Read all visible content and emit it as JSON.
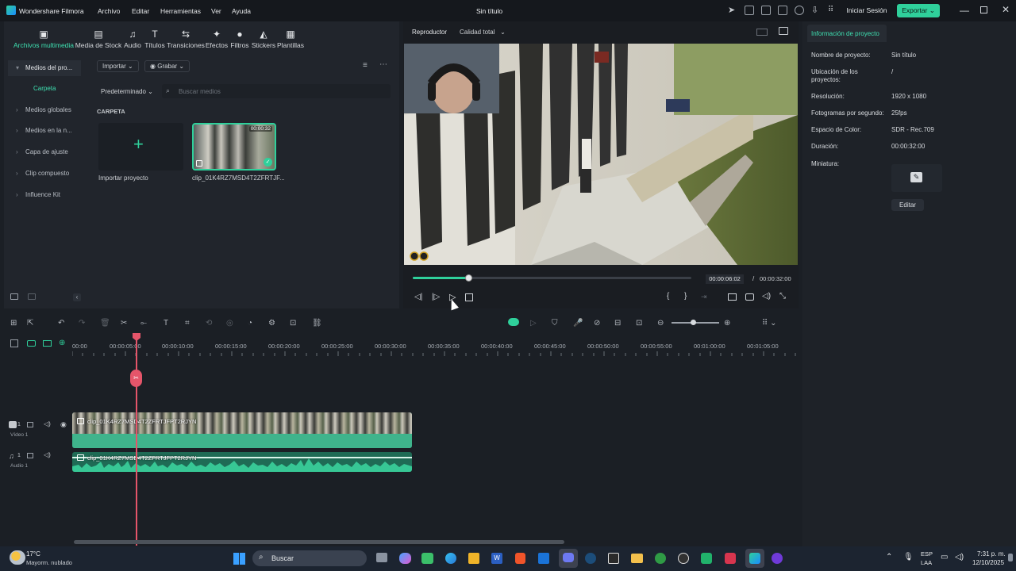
{
  "app": {
    "name": "Wondershare Filmora",
    "title": "Sin título"
  },
  "menu": [
    "Archivo",
    "Editar",
    "Herramientas",
    "Ver",
    "Ayuda"
  ],
  "header": {
    "login": "Iniciar Sesión",
    "export": "Exportar"
  },
  "media_tabs": [
    "Archivos multimedia",
    "Media de Stock",
    "Audio",
    "Títulos",
    "Transiciones",
    "Efectos",
    "Filtros",
    "Stickers",
    "Plantillas"
  ],
  "sidebar": {
    "items": [
      "Medios del pro...",
      "Carpeta",
      "Medios globales",
      "Medios en la n...",
      "Capa de ajuste",
      "Clip compuesto",
      "Influence Kit"
    ]
  },
  "media": {
    "import_btn": "Importar",
    "record_btn": "Grabar",
    "sort": "Predeterminado",
    "search_placeholder": "Buscar medios",
    "folder_heading": "CARPETA",
    "import_project": "Importar proyecto",
    "clip_name": "clip_01K4RZ7MSD4T2ZFRTJF...",
    "clip_duration": "00:00:32"
  },
  "player": {
    "label": "Reproductor",
    "quality": "Calidad total",
    "current_time": "00:00:06:02",
    "separator": "/",
    "total_time": "00:00:32:00",
    "progress": 0.2
  },
  "project_info": {
    "title": "Información de proyecto",
    "rows": [
      {
        "label": "Nombre de proyecto:",
        "value": "Sin título"
      },
      {
        "label": "Ubicación de los proyectos:",
        "value": "/"
      },
      {
        "label": "Resolución:",
        "value": "1920 x 1080"
      },
      {
        "label": "Fotogramas por segundo:",
        "value": "25fps"
      },
      {
        "label": "Espacio de Color:",
        "value": "SDR - Rec.709"
      },
      {
        "label": "Duración:",
        "value": "00:00:32:00"
      },
      {
        "label": "Miniatura:",
        "value": ""
      }
    ],
    "edit_btn": "Editar"
  },
  "timeline": {
    "ruler": [
      "00:00",
      "00:00:05:00",
      "00:00:10:00",
      "00:00:15:00",
      "00:00:20:00",
      "00:00:25:00",
      "00:00:30:00",
      "00:00:35:00",
      "00:00:40:00",
      "00:00:45:00",
      "00:00:50:00",
      "00:00:55:00",
      "00:01:00:00",
      "00:01:05:00"
    ],
    "video_track": {
      "num": "1",
      "label": "Vídeo 1"
    },
    "audio_track": {
      "num": "1",
      "label": "Audio 1"
    },
    "video_clip": "clip_01K4RZ7MSD4T2ZFRTJFPT2RJYN",
    "audio_clip": "clip_01K4RZ7MSD4T2ZFRTJFPT2RJYN",
    "accent": "#2fd09b",
    "playhead_color": "#e5556a"
  },
  "taskbar": {
    "weather_temp": "17°C",
    "weather_desc": "Mayorm. nublado",
    "search": "Buscar",
    "lang1": "ESP",
    "lang2": "LAA",
    "time": "7:31 p. m.",
    "date": "12/10/2025"
  }
}
